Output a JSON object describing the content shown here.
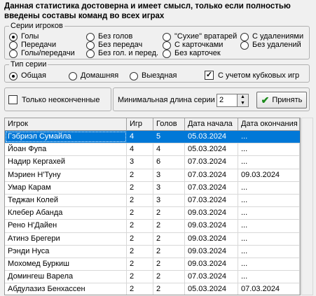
{
  "note": "Данная статистика достоверна и имеет смысл, только если полностью введены составы команд во всех играх",
  "series_group": {
    "title": "Серии игроков",
    "options": [
      {
        "label": "Голы",
        "selected": true
      },
      {
        "label": "Передачи",
        "selected": false
      },
      {
        "label": "Голы/передачи",
        "selected": false
      },
      {
        "label": "Без голов",
        "selected": false
      },
      {
        "label": "Без передач",
        "selected": false
      },
      {
        "label": "Без гол. и перед.",
        "selected": false
      },
      {
        "label": "\"Сухие\" вратарей",
        "selected": false
      },
      {
        "label": "С карточками",
        "selected": false
      },
      {
        "label": "Без карточек",
        "selected": false
      },
      {
        "label": "С удалениями",
        "selected": false
      },
      {
        "label": "Без удалений",
        "selected": false
      }
    ]
  },
  "type_group": {
    "title": "Тип серии",
    "options": [
      {
        "label": "Общая",
        "selected": true
      },
      {
        "label": "Домашняя",
        "selected": false
      },
      {
        "label": "Выездная",
        "selected": false
      }
    ],
    "cup_games_label": "С учетом кубковых игр",
    "cup_games_checked": true
  },
  "controls": {
    "unfinished_only_label": "Только неоконченные",
    "unfinished_only_checked": false,
    "min_length_label": "Минимальная длина серии",
    "min_length_value": "2",
    "accept_label": "Принять"
  },
  "table": {
    "columns": [
      "Игрок",
      "Игр",
      "Голов",
      "Дата начала",
      "Дата окончания"
    ],
    "rows": [
      [
        "Гэбриэл Сумайла",
        "4",
        "5",
        "05.03.2024",
        "..."
      ],
      [
        "Йоан Фупа",
        "4",
        "4",
        "05.03.2024",
        "..."
      ],
      [
        "Надир Кергахей",
        "3",
        "6",
        "07.03.2024",
        "..."
      ],
      [
        "Мэриен Н'Туну",
        "2",
        "3",
        "07.03.2024",
        "09.03.2024"
      ],
      [
        "Умар Карам",
        "2",
        "3",
        "07.03.2024",
        "..."
      ],
      [
        "Теджан Колей",
        "2",
        "3",
        "07.03.2024",
        "..."
      ],
      [
        "Клебер Абанда",
        "2",
        "2",
        "09.03.2024",
        "..."
      ],
      [
        "Рено Н'Дайен",
        "2",
        "2",
        "09.03.2024",
        "..."
      ],
      [
        "Атинэ Брегери",
        "2",
        "2",
        "09.03.2024",
        "..."
      ],
      [
        "Рэнди Нуса",
        "2",
        "2",
        "09.03.2024",
        "..."
      ],
      [
        "Мохомед Буркиш",
        "2",
        "2",
        "09.03.2024",
        "..."
      ],
      [
        "Домингеш Варела",
        "2",
        "2",
        "07.03.2024",
        "..."
      ],
      [
        "Абдулазиз Бенхассен",
        "2",
        "2",
        "05.03.2024",
        "07.03.2024"
      ]
    ],
    "selected_row": 0
  }
}
